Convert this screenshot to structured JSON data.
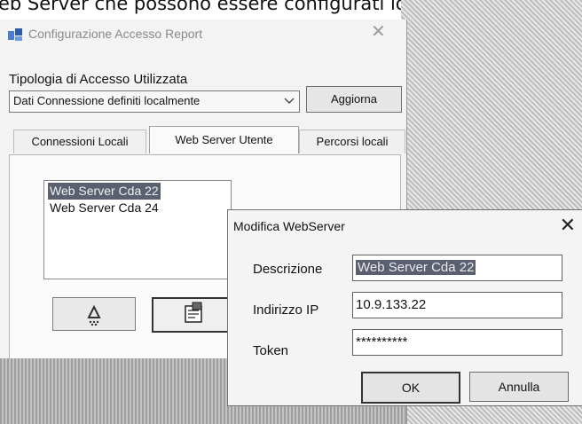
{
  "document": {
    "partial_text": "eb Server che possono essere configurati loca"
  },
  "main_window": {
    "title": "Configurazione Accesso Report",
    "close_glyph": "✕",
    "access_type_label": "Tipologia di Accesso Utilizzata",
    "access_type_selected": "Dati Connessione definiti localmente",
    "refresh_button": "Aggiorna",
    "tabs": [
      {
        "label": "Connessioni Locali",
        "active": false
      },
      {
        "label": "Web Server Utente",
        "active": true
      },
      {
        "label": "Percorsi locali",
        "active": false
      }
    ],
    "web_servers": [
      {
        "name": "Web Server Cda 22",
        "selected": true
      },
      {
        "name": "Web Server Cda 24",
        "selected": false
      }
    ],
    "toolbar_icons": [
      "new-item-icon",
      "edit-properties-icon"
    ]
  },
  "edit_dialog": {
    "title": "Modifica WebServer",
    "close_glyph": "✕",
    "fields": {
      "descrizione": {
        "label": "Descrizione",
        "value": "Web Server Cda 22"
      },
      "indirizzo_ip": {
        "label": "Indirizzo IP",
        "value": "10.9.133.22"
      },
      "token": {
        "label": "Token",
        "value": "**********"
      }
    },
    "ok_button": "OK",
    "cancel_button": "Annulla"
  },
  "colors": {
    "selection": "#5a6070",
    "dialog_bg": "#f4f4f4"
  }
}
